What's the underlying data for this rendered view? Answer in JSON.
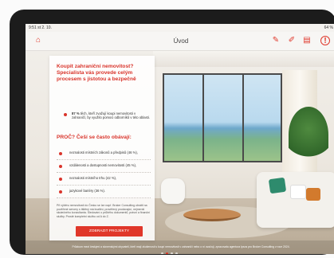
{
  "status_bar": {
    "time": "9:51",
    "date": "st 2. 10.",
    "indicators": "64 %"
  },
  "app_bar": {
    "title": "Úvod"
  },
  "card": {
    "heading": "Koupit zahraniční nemovitost? Specialista vás provede celým procesem s jistotou a bezpečně",
    "intro_bold": "87 %",
    "intro_rest": "těch, kteří zvažují koupi nemovitosti v zahraničí, by využilo pomoci odborníků v této oblasti.",
    "subheading": "PROČ? Češí se často obávají:",
    "items": [
      "neznalosti místních zákonů a předpisů (46 %),",
      "vzdálenosti a dostupnosti nemovitosti (45 %),",
      "neznalosti místního trhu (42 %),",
      "jazykové bariéry (36 %)."
    ],
    "note": "Při výběru nemovitosti do Česko se lze např. Broker Consulting obrátit na pověřené servery s tištěný má kvalitní, prověřený prodávající, nejmenší skutečného konzultanta. Sledování o průběhu dokumentů, právní a finanční služby. Prosté kompletní službu od A do Z.",
    "cta_label": "ZOBRAZIT PROJEKTY"
  },
  "caption": "Průzkum mezi českými a slovenskými obyvateli, kteří mají zkušenosti s koupí nemovitosti v zahraničí nebo o ní uvažují, zpracovala agentura Ipsos pro Broker Consulting v roce 2024.",
  "pager": {
    "pages": 4,
    "active_index": 1
  },
  "colors": {
    "accent": "#e0372a",
    "heading_red": "#d9342b",
    "tablet_frame": "#1c1c1c"
  },
  "icons": [
    "home-icon",
    "megaphone-icon",
    "pin-icon",
    "document-icon",
    "exclamation-icon"
  ]
}
